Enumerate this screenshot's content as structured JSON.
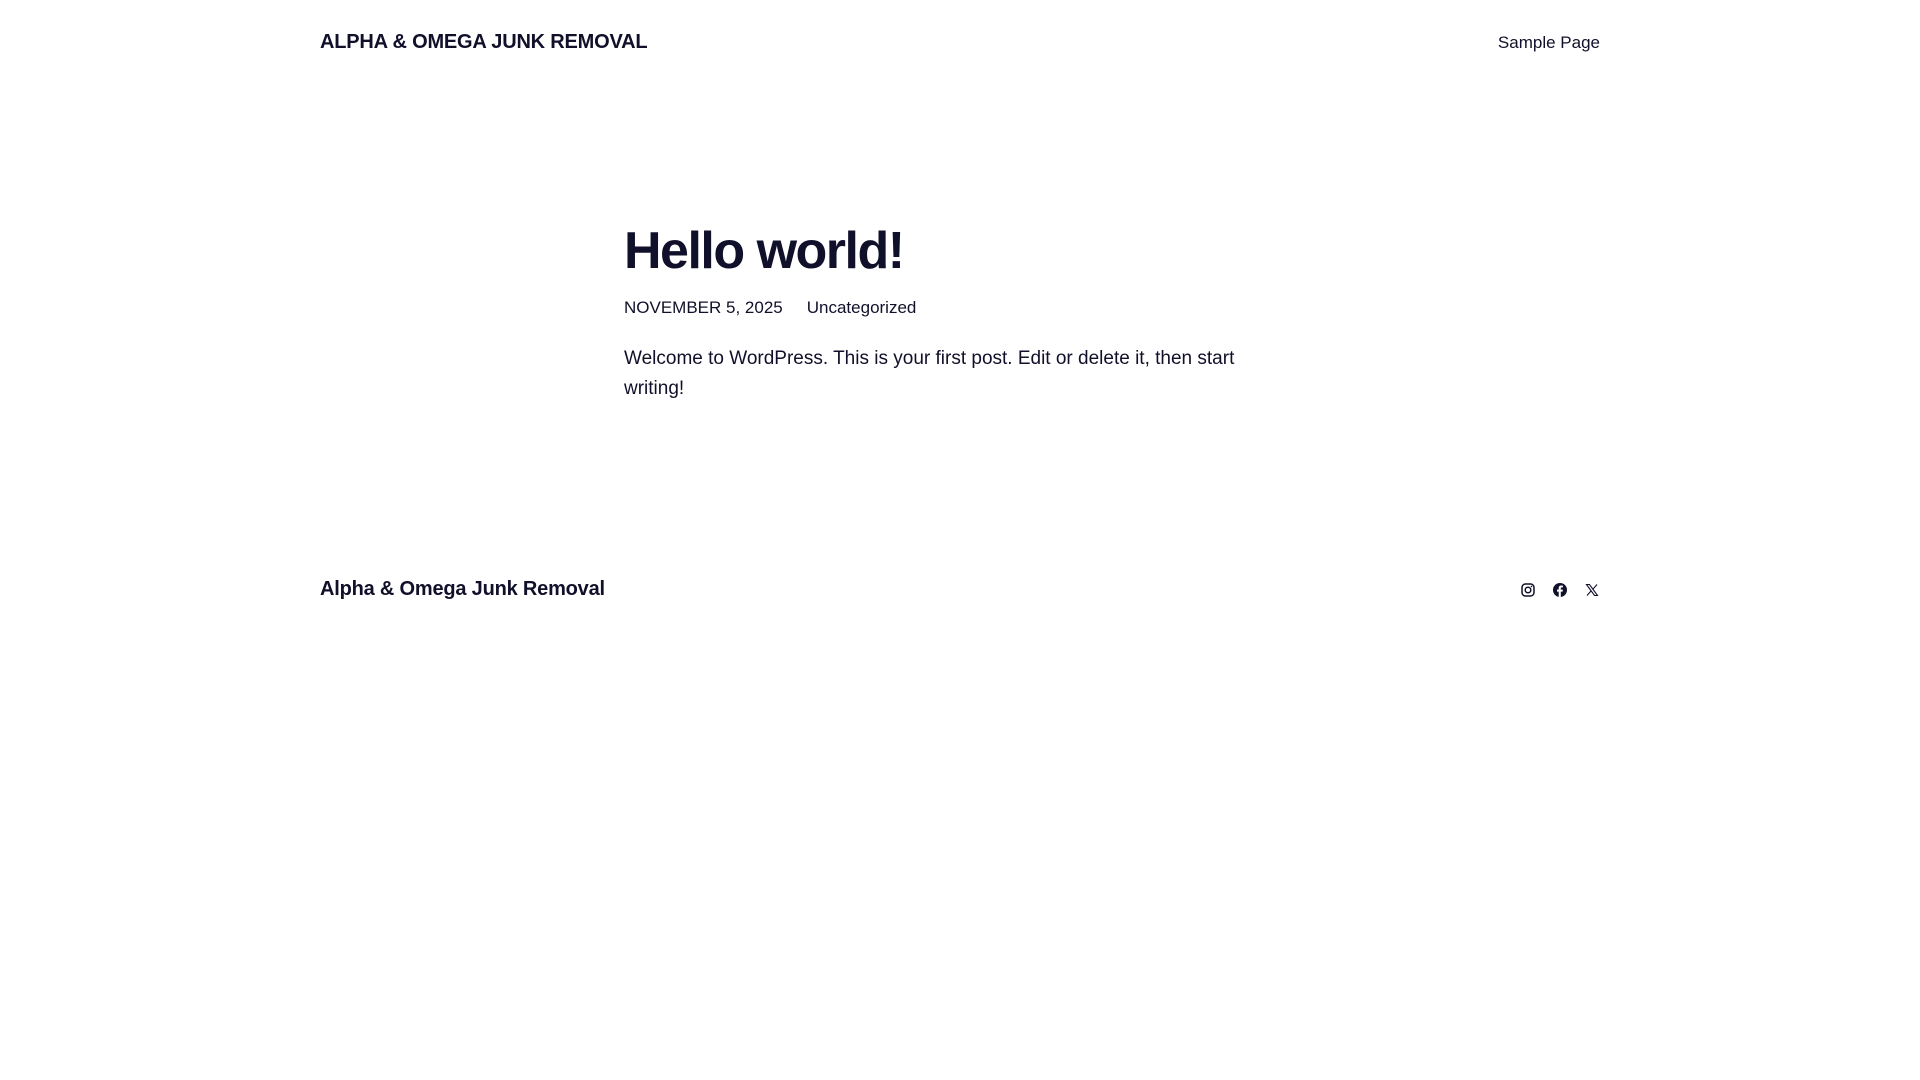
{
  "header": {
    "site_title": "ALPHA & OMEGA JUNK REMOVAL",
    "nav_items": [
      "Sample Page"
    ]
  },
  "post": {
    "title": "Hello world!",
    "date": "NOVEMBER 5, 2025",
    "category": "Uncategorized",
    "content": "Welcome to WordPress. This is your first post. Edit or delete it, then start writing!"
  },
  "footer": {
    "site_title": "Alpha & Omega Junk Removal",
    "social_icons": [
      "instagram-icon",
      "facebook-icon",
      "x-icon"
    ]
  },
  "colors": {
    "text": "#11102a",
    "background": "#ffffff"
  }
}
